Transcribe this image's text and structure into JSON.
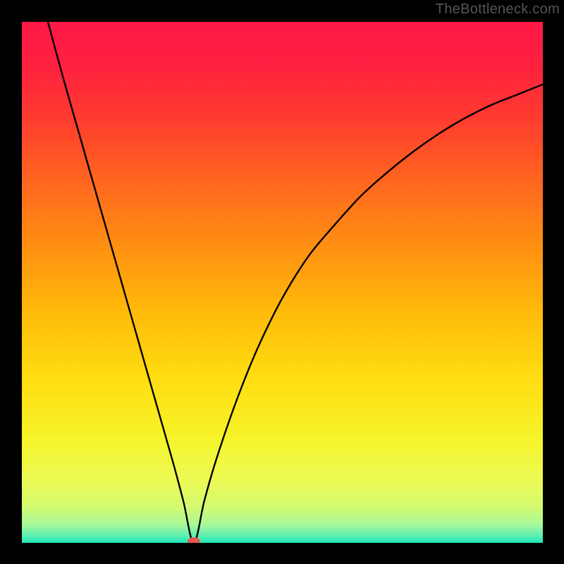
{
  "watermark": "TheBottleneck.com",
  "chart_data": {
    "type": "line",
    "title": "",
    "xlabel": "",
    "ylabel": "",
    "xlim": [
      0,
      100
    ],
    "ylim": [
      0,
      100
    ],
    "grid": false,
    "legend": false,
    "minimum_marker": {
      "x": 33,
      "y": 0,
      "color": "#e85a4f"
    },
    "series": [
      {
        "name": "bottleneck-curve",
        "color": "#000000",
        "x": [
          5,
          8,
          11,
          14,
          17,
          20,
          23,
          26,
          29,
          31,
          33,
          35,
          37,
          40,
          43,
          46,
          50,
          55,
          60,
          65,
          70,
          75,
          80,
          85,
          90,
          95,
          100
        ],
        "y": [
          100,
          89,
          78.5,
          68,
          57.5,
          47,
          36.5,
          26,
          15.5,
          8,
          0,
          8,
          15,
          24,
          32,
          39,
          47,
          55,
          61,
          66.5,
          71,
          75,
          78.5,
          81.5,
          84,
          86,
          88
        ]
      }
    ],
    "background_gradient": {
      "stops": [
        {
          "offset": 0.0,
          "color": "#ff1848"
        },
        {
          "offset": 0.08,
          "color": "#ff2040"
        },
        {
          "offset": 0.18,
          "color": "#ff3a30"
        },
        {
          "offset": 0.3,
          "color": "#ff6420"
        },
        {
          "offset": 0.42,
          "color": "#ff8c12"
        },
        {
          "offset": 0.55,
          "color": "#ffb80a"
        },
        {
          "offset": 0.68,
          "color": "#ffdc10"
        },
        {
          "offset": 0.8,
          "color": "#f6f42a"
        },
        {
          "offset": 0.88,
          "color": "#ecfa55"
        },
        {
          "offset": 0.93,
          "color": "#d4fa70"
        },
        {
          "offset": 0.965,
          "color": "#a8f898"
        },
        {
          "offset": 0.985,
          "color": "#60f0b0"
        },
        {
          "offset": 1.0,
          "color": "#20e8b8"
        }
      ]
    }
  }
}
